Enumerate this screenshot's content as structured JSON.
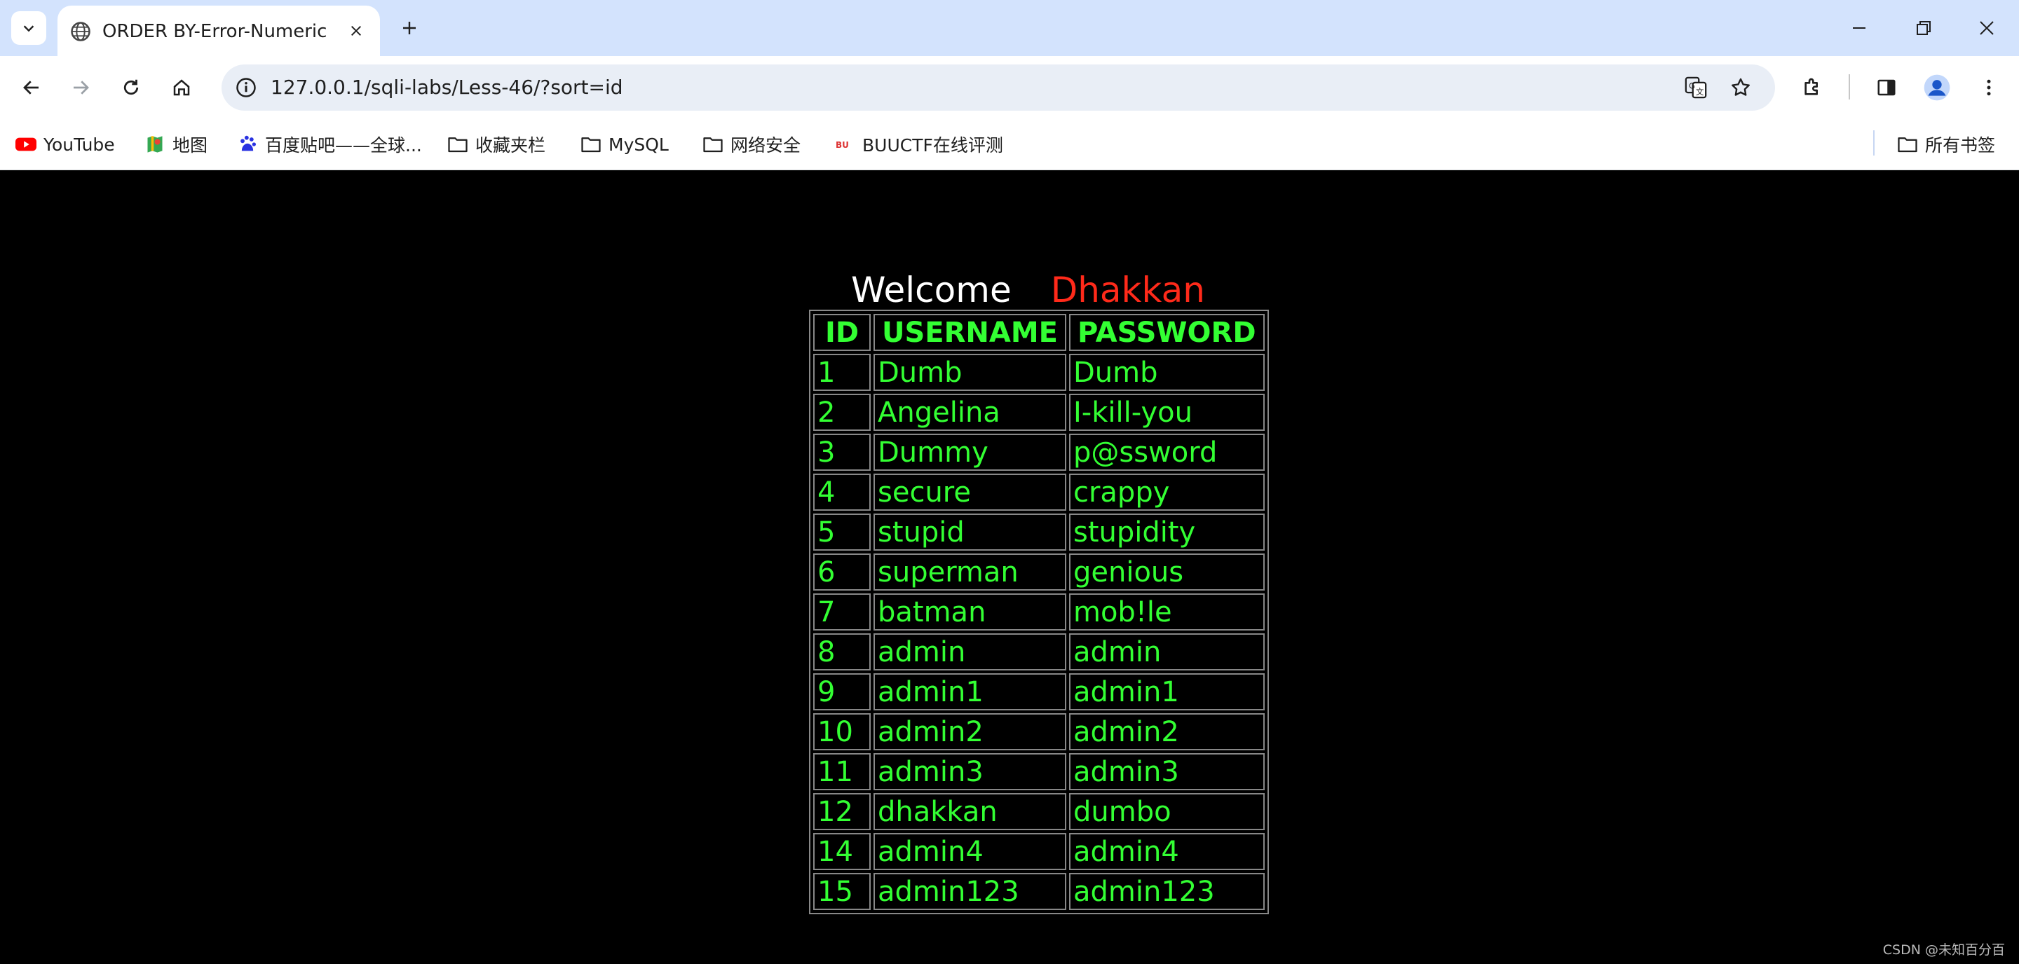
{
  "browser": {
    "tab": {
      "title": "ORDER BY-Error-Numeric"
    },
    "url": "127.0.0.1/sqli-labs/Less-46/?sort=id",
    "bookmarks": [
      {
        "label": "YouTube",
        "icon": "youtube-icon"
      },
      {
        "label": "地图",
        "icon": "maps-icon"
      },
      {
        "label": "百度贴吧——全球...",
        "icon": "baidu-icon"
      },
      {
        "label": "收藏夹栏",
        "icon": "folder-icon"
      },
      {
        "label": "MySQL",
        "icon": "folder-icon"
      },
      {
        "label": "网络安全",
        "icon": "folder-icon"
      },
      {
        "label": "BUUCTF在线评测",
        "icon": "buuctf-icon"
      }
    ],
    "all_bookmarks": "所有书签"
  },
  "page": {
    "welcome": "Welcome",
    "user": "Dhakkan",
    "table": {
      "headers": [
        "ID",
        "USERNAME",
        "PASSWORD"
      ],
      "rows": [
        [
          "1",
          "Dumb",
          "Dumb"
        ],
        [
          "2",
          "Angelina",
          "I-kill-you"
        ],
        [
          "3",
          "Dummy",
          "p@ssword"
        ],
        [
          "4",
          "secure",
          "crappy"
        ],
        [
          "5",
          "stupid",
          "stupidity"
        ],
        [
          "6",
          "superman",
          "genious"
        ],
        [
          "7",
          "batman",
          "mob!le"
        ],
        [
          "8",
          "admin",
          "admin"
        ],
        [
          "9",
          "admin1",
          "admin1"
        ],
        [
          "10",
          "admin2",
          "admin2"
        ],
        [
          "11",
          "admin3",
          "admin3"
        ],
        [
          "12",
          "dhakkan",
          "dumbo"
        ],
        [
          "14",
          "admin4",
          "admin4"
        ],
        [
          "15",
          "admin123",
          "admin123"
        ]
      ]
    },
    "watermark": "CSDN @未知百分百"
  },
  "colors": {
    "page_bg": "#000000",
    "table_text": "#33ff33",
    "user_name": "#ff2a1a",
    "tabstrip": "#d3e3fd"
  }
}
